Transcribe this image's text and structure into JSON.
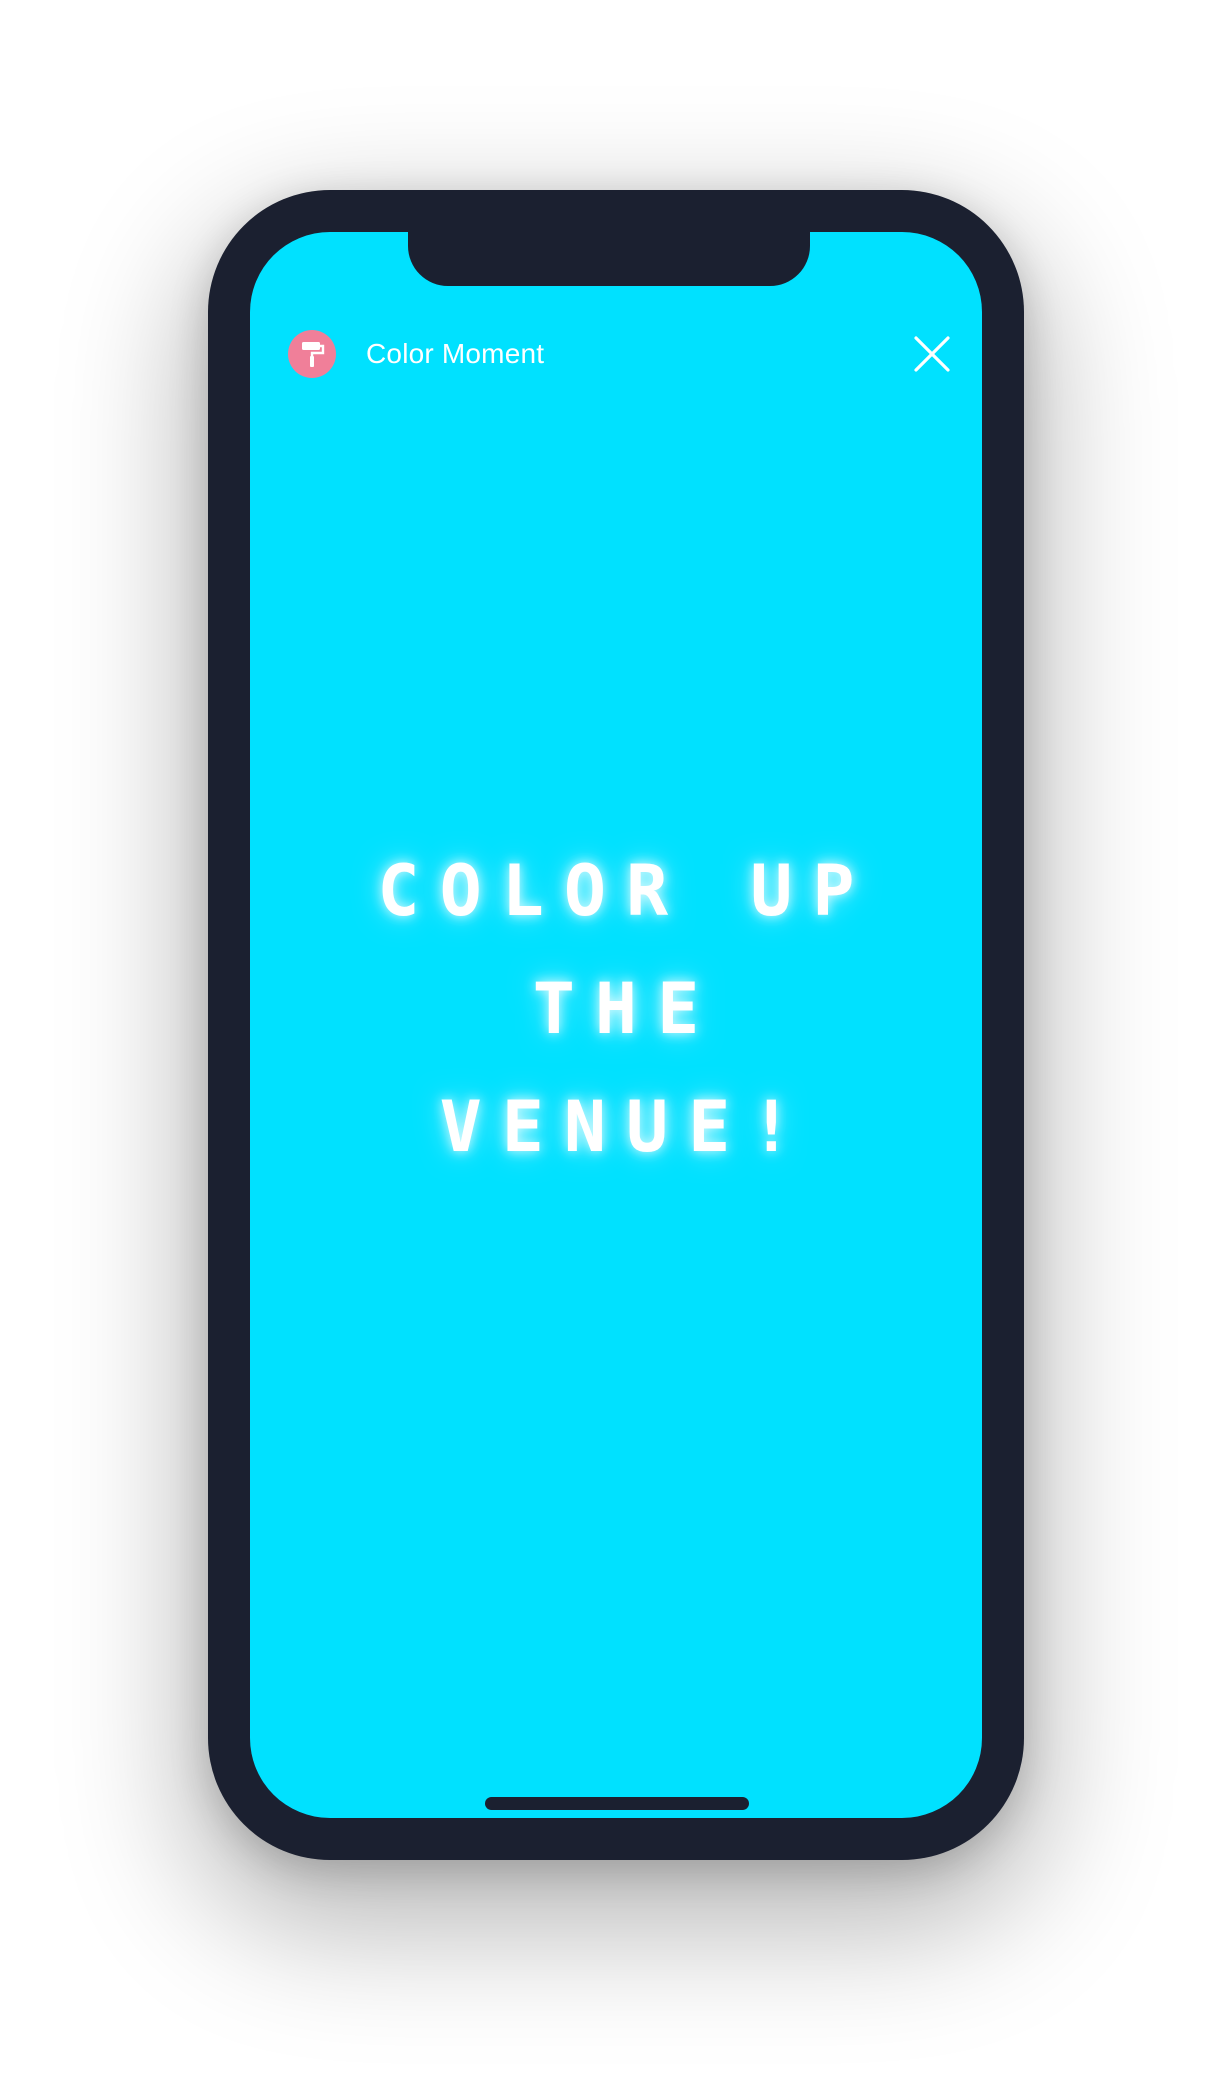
{
  "app": {
    "title": "Color Moment",
    "icon": "paint-roller-icon",
    "close_icon": "close-icon"
  },
  "content": {
    "headline_lines": [
      "Color up",
      "the",
      "venue!"
    ]
  },
  "colors": {
    "screen_background": "#00e1ff",
    "device_frame": "#1b2030",
    "brand_icon_background": "#f07f99",
    "text": "#ffffff"
  }
}
